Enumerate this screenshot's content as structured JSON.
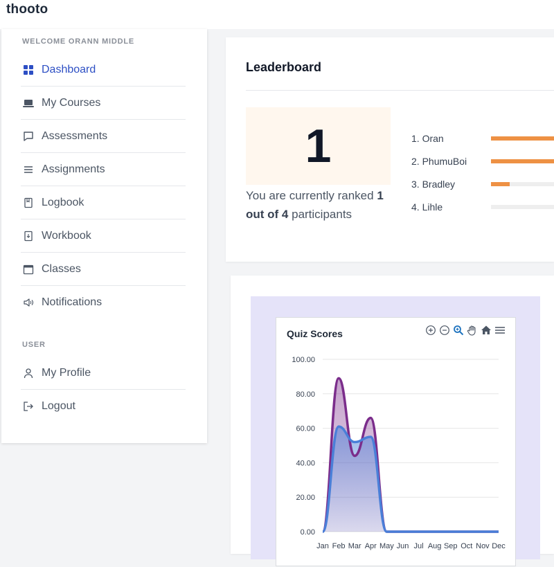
{
  "app": {
    "brand": "thooto"
  },
  "sidebar": {
    "welcome": "WELCOME ORANN MIDDLE",
    "items": [
      {
        "label": "Dashboard",
        "icon": "grid-icon"
      },
      {
        "label": "My Courses",
        "icon": "laptop-icon"
      },
      {
        "label": "Assessments",
        "icon": "chat-icon"
      },
      {
        "label": "Assignments",
        "icon": "list-icon"
      },
      {
        "label": "Logbook",
        "icon": "book-icon"
      },
      {
        "label": "Workbook",
        "icon": "workbook-icon"
      },
      {
        "label": "Classes",
        "icon": "calendar-icon"
      },
      {
        "label": "Notifications",
        "icon": "speaker-icon"
      }
    ],
    "user_section": "USER",
    "user_items": [
      {
        "label": "My Profile",
        "icon": "user-icon"
      },
      {
        "label": "Logout",
        "icon": "logout-icon"
      }
    ]
  },
  "leaderboard": {
    "title": "Leaderboard",
    "rank": "1",
    "rank_text_prefix": "You are currently ranked ",
    "rank_text_bold": "1 out of 4",
    "rank_text_suffix": " participants",
    "entries": [
      {
        "label": "1. Oran",
        "progress": 1.0
      },
      {
        "label": "2. PhumuBoi",
        "progress": 1.0
      },
      {
        "label": "3. Bradley",
        "progress": 0.27
      },
      {
        "label": "4. Lihle",
        "progress": 0.0
      }
    ],
    "accent": "#ee9144"
  },
  "chart_data": {
    "type": "area",
    "title": "Quiz Scores",
    "categories": [
      "Jan",
      "Feb",
      "Mar",
      "Apr",
      "May",
      "Jun",
      "Jul",
      "Aug",
      "Sep",
      "Oct",
      "Nov",
      "Dec"
    ],
    "ylim": [
      0,
      100
    ],
    "yticks": [
      "0.00",
      "20.00",
      "40.00",
      "60.00",
      "80.00",
      "100.00"
    ],
    "xlabel": "",
    "ylabel": "",
    "series": [
      {
        "values": [
          0,
          61,
          52,
          55,
          0,
          0,
          0,
          0,
          0,
          0,
          0,
          0
        ],
        "color": "#4a7fd8"
      },
      {
        "values": [
          0,
          89,
          44,
          66,
          0,
          0,
          0,
          0,
          0,
          0,
          0,
          0
        ],
        "color": "#7b2d8b"
      }
    ],
    "toolbar": [
      "zoom-in-icon",
      "zoom-out-icon",
      "magnify-icon",
      "pan-hand-icon",
      "home-icon",
      "menu-icon"
    ],
    "grid": true,
    "background": "#e5e3f9"
  }
}
